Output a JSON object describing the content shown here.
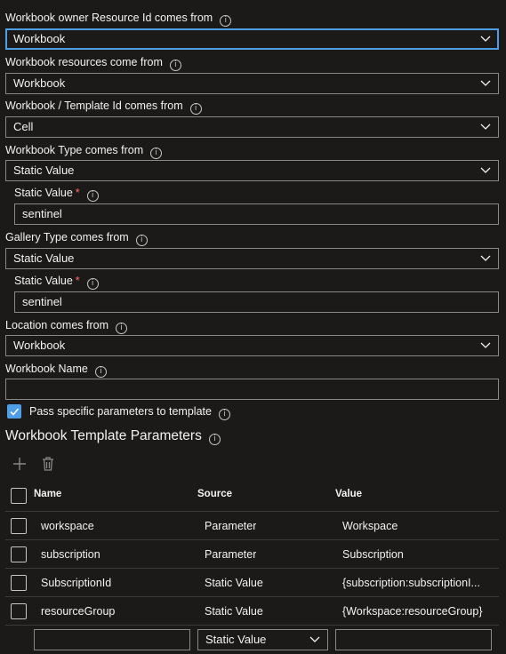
{
  "fields": [
    {
      "label": "Workbook owner Resource Id comes from",
      "value": "Workbook"
    },
    {
      "label": "Workbook resources come from",
      "value": "Workbook"
    },
    {
      "label": "Workbook / Template Id comes from",
      "value": "Cell"
    },
    {
      "label": "Workbook Type comes from",
      "value": "Static Value"
    },
    {
      "label": "Gallery Type comes from",
      "value": "Static Value"
    },
    {
      "label": "Location comes from",
      "value": "Workbook"
    }
  ],
  "static_values": [
    {
      "label": "Static Value",
      "value": "sentinel"
    },
    {
      "label": "Static Value",
      "value": "sentinel"
    }
  ],
  "workbook_name": {
    "label": "Workbook Name",
    "value": ""
  },
  "pass_params": {
    "label": "Pass specific parameters to template",
    "checked": true
  },
  "template_params": {
    "title": "Workbook Template Parameters",
    "headers": {
      "name": "Name",
      "source": "Source",
      "value": "Value"
    },
    "rows": [
      {
        "name": "workspace",
        "source": "Parameter",
        "value": "Workspace"
      },
      {
        "name": "subscription",
        "source": "Parameter",
        "value": "Subscription"
      },
      {
        "name": "SubscriptionId",
        "source": "Static Value",
        "value": "{subscription:subscriptionI..."
      },
      {
        "name": "resourceGroup",
        "source": "Static Value",
        "value": "{Workspace:resourceGroup}"
      }
    ],
    "new_row": {
      "source": "Static Value"
    }
  },
  "icons": {
    "info": "i",
    "required": "*"
  },
  "colors": {
    "accent": "#4f9ee8",
    "required": "#ff6b6b",
    "background": "#1b1a19"
  }
}
